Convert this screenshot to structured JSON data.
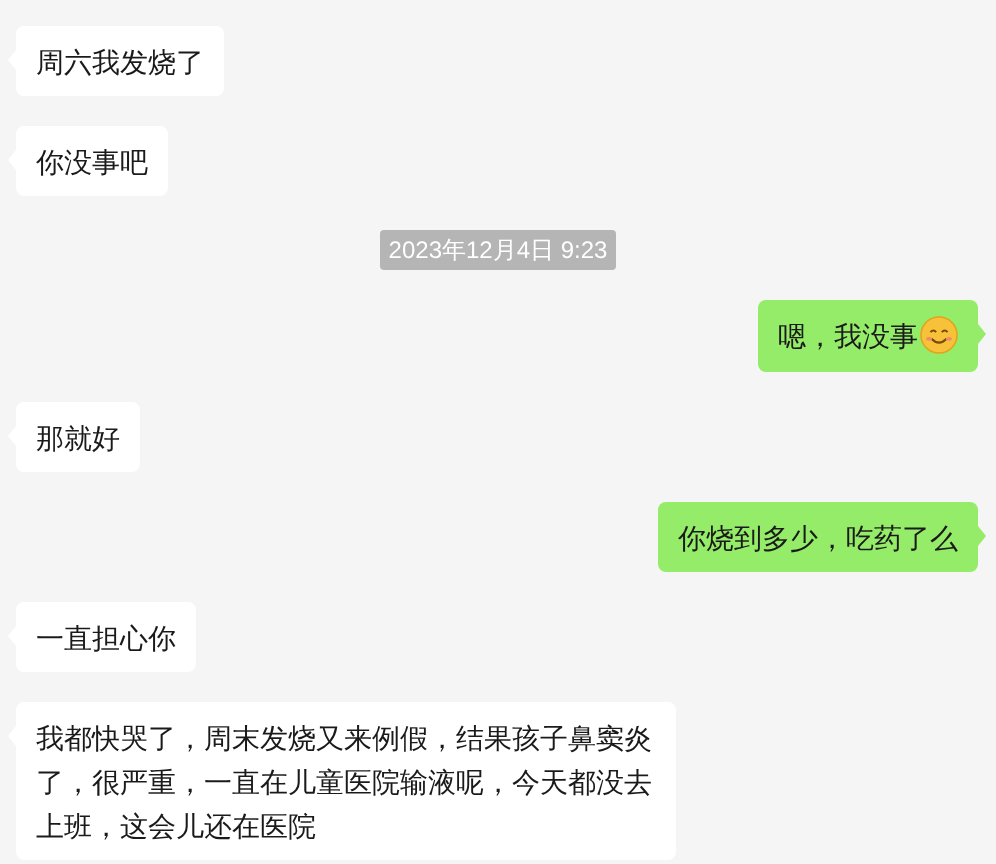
{
  "messages": [
    {
      "kind": "incoming",
      "text": "周六我发烧了"
    },
    {
      "kind": "incoming",
      "text": "你没事吧"
    },
    {
      "kind": "timestamp",
      "text": "2023年12月4日 9:23"
    },
    {
      "kind": "outgoing",
      "text": "嗯，我没事",
      "emoji": true
    },
    {
      "kind": "incoming",
      "text": "那就好"
    },
    {
      "kind": "outgoing",
      "text": "你烧到多少，吃药了么"
    },
    {
      "kind": "incoming",
      "text": "一直担心你"
    },
    {
      "kind": "incoming",
      "text": "我都快哭了，周末发烧又来例假，结果孩子鼻窦炎了，很严重，一直在儿童医院输液呢，今天都没去上班，这会儿还在医院"
    }
  ]
}
